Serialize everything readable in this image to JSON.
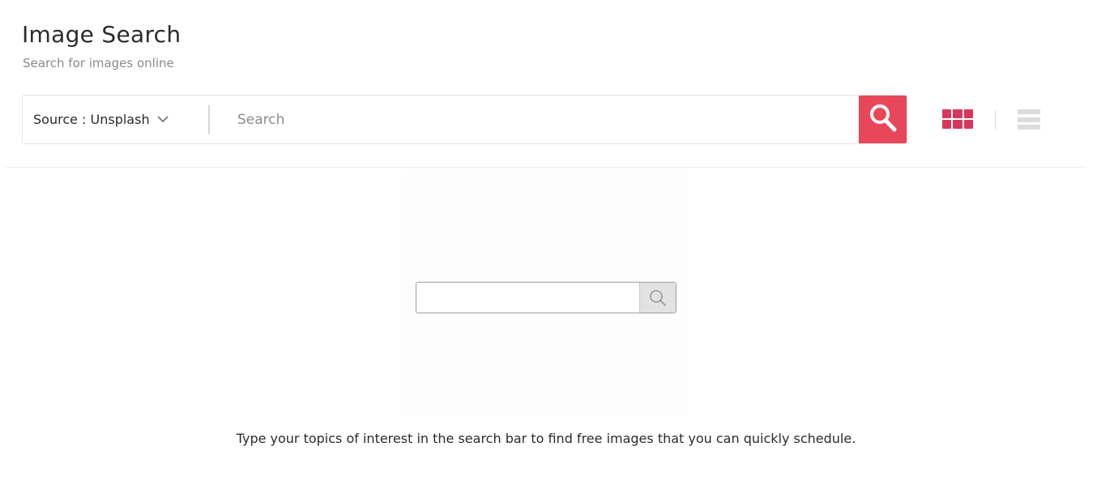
{
  "header": {
    "title": "Image Search",
    "subtitle": "Search for images online"
  },
  "search": {
    "source_label": "Source : Unsplash",
    "placeholder": "Search",
    "value": "",
    "button_icon": "search-icon"
  },
  "view_toggle": {
    "grid_icon": "grid-view-icon",
    "list_icon": "list-view-icon",
    "active": "grid"
  },
  "empty_state": {
    "illustration_icon": "search-icon",
    "hint": "Type your topics of interest in the search bar to find free images that you can quickly schedule."
  },
  "colors": {
    "accent": "#e8475a",
    "grid_active": "#d8375b",
    "list_inactive": "#dcdcdc"
  }
}
